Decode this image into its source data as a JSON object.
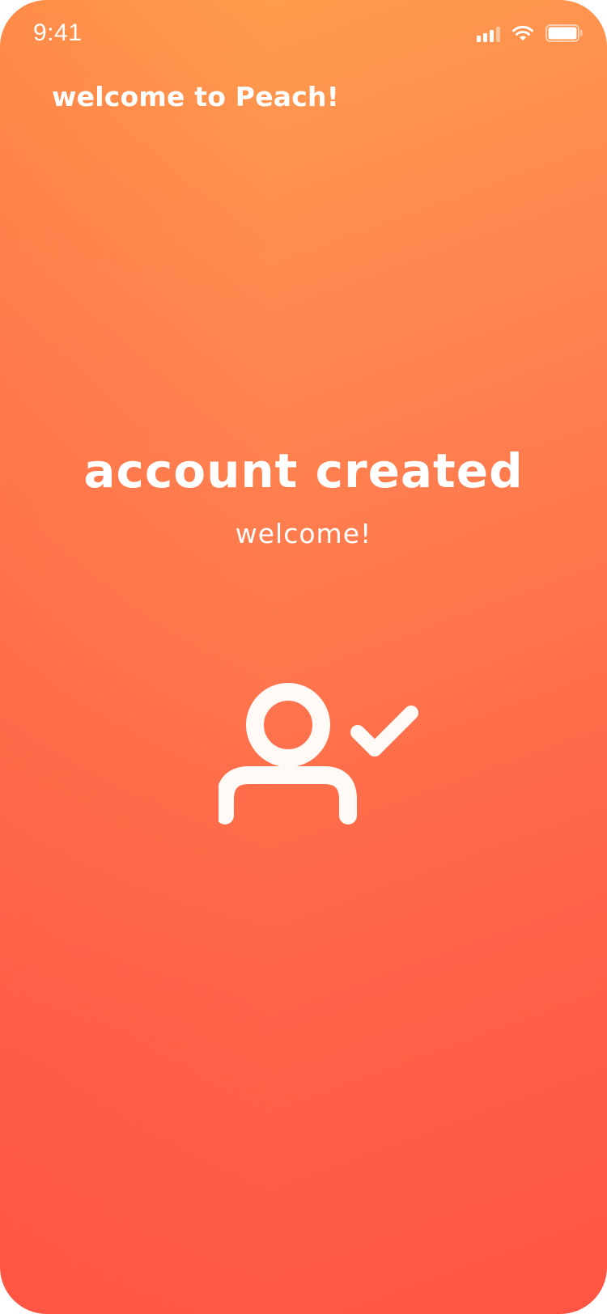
{
  "status_bar": {
    "time": "9:41",
    "icons": [
      "cellular-signal-icon",
      "wifi-icon",
      "battery-icon"
    ]
  },
  "header": {
    "title": "welcome to Peach!"
  },
  "main": {
    "headline": "account created",
    "subheadline": "welcome!",
    "illustration": "user-check-icon"
  },
  "colors": {
    "gradient_top_right": "#ffa24c",
    "gradient_bottom_left": "#ff5443",
    "text": "#ffffff"
  }
}
